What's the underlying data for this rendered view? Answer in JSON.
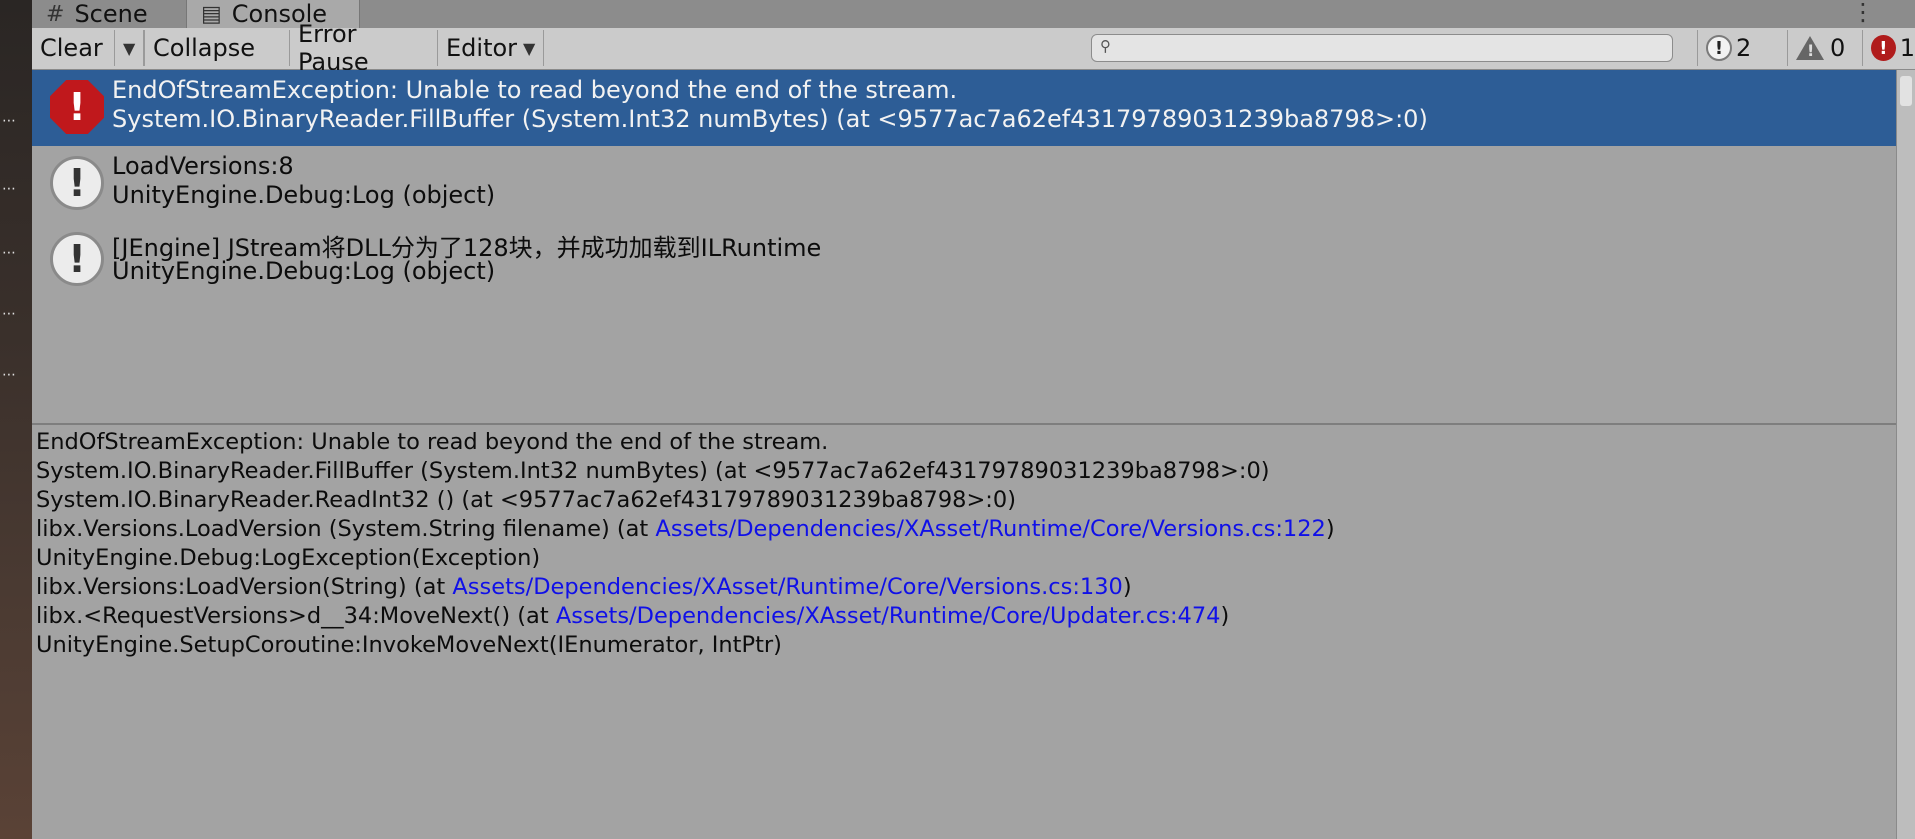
{
  "tabs": {
    "scene_label": "Scene",
    "console_label": "Console",
    "scene_icon": "grid-icon",
    "console_icon": "console-icon"
  },
  "toolbar": {
    "clear_label": "Clear",
    "collapse_label": "Collapse",
    "error_pause_label": "Error Pause",
    "editor_label": "Editor",
    "search_placeholder": "",
    "search_value": "",
    "counts": {
      "info": "2",
      "warning": "0",
      "error": "1"
    }
  },
  "log_entries": [
    {
      "type": "error",
      "line1": "EndOfStreamException: Unable to read beyond the end of the stream.",
      "line2": "System.IO.BinaryReader.FillBuffer (System.Int32 numBytes) (at <9577ac7a62ef43179789031239ba8798>:0)",
      "selected": true
    },
    {
      "type": "info",
      "line1": "LoadVersions:8",
      "line2": "UnityEngine.Debug:Log (object)",
      "selected": false
    },
    {
      "type": "info",
      "line1": "[JEngine] JStream将DLL分为了128块，并成功加载到ILRuntime",
      "line2": "UnityEngine.Debug:Log (object)",
      "selected": false
    }
  ],
  "detail": {
    "l1": "EndOfStreamException: Unable to read beyond the end of the stream.",
    "l2": "System.IO.BinaryReader.FillBuffer (System.Int32 numBytes) (at <9577ac7a62ef43179789031239ba8798>:0)",
    "l3": "System.IO.BinaryReader.ReadInt32 () (at <9577ac7a62ef43179789031239ba8798>:0)",
    "l4_pre": "libx.Versions.LoadVersion (System.String filename) (at ",
    "l4_link": "Assets/Dependencies/XAsset/Runtime/Core/Versions.cs:122",
    "l4_post": ")",
    "l5": "UnityEngine.Debug:LogException(Exception)",
    "l6_pre": "libx.Versions:LoadVersion(String) (at ",
    "l6_link": "Assets/Dependencies/XAsset/Runtime/Core/Versions.cs:130",
    "l6_post": ")",
    "l7_pre": "libx.<RequestVersions>d__34:MoveNext() (at ",
    "l7_link": "Assets/Dependencies/XAsset/Runtime/Core/Updater.cs:474",
    "l7_post": ")",
    "l8": "UnityEngine.SetupCoroutine:InvokeMoveNext(IEnumerator, IntPtr)"
  },
  "colors": {
    "selected_row": "#2d5d96",
    "error_icon": "#c0181c",
    "link": "#1010e8",
    "background": "#a3a3a3"
  }
}
